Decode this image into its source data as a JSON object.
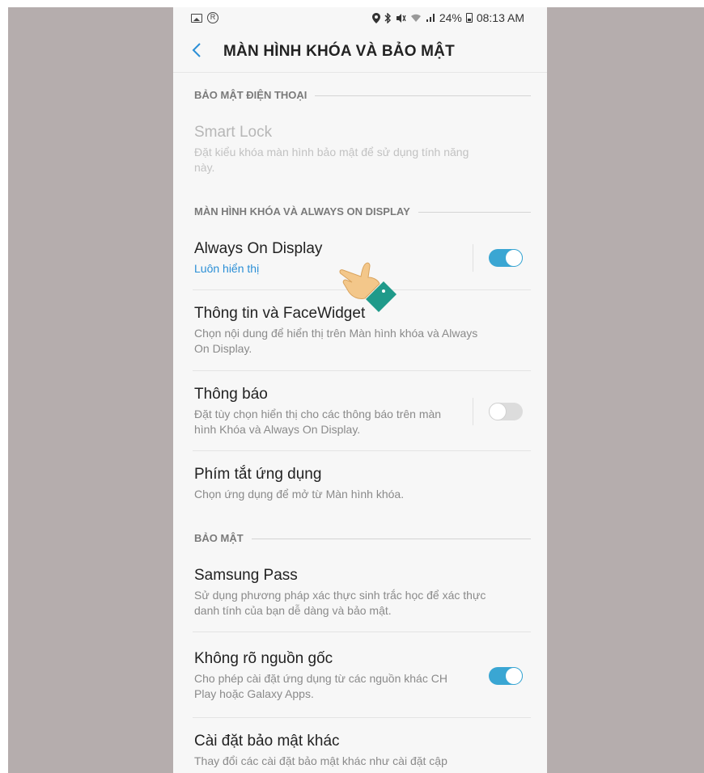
{
  "status_bar": {
    "battery": "24%",
    "time": "08:13 AM"
  },
  "header": {
    "title": "MÀN HÌNH KHÓA VÀ BẢO MẬT"
  },
  "sections": {
    "phone_security": "BẢO MẬT ĐIỆN THOẠI",
    "lock_aod": "MÀN HÌNH KHÓA VÀ ALWAYS ON DISPLAY",
    "security": "BẢO MẬT"
  },
  "items": {
    "smart_lock": {
      "title": "Smart Lock",
      "desc": "Đặt kiểu khóa màn hình bảo mật để sử dụng tính năng này."
    },
    "aod": {
      "title": "Always On Display",
      "sub": "Luôn hiển thị",
      "toggle": "on"
    },
    "facewidget": {
      "title": "Thông tin và FaceWidget",
      "desc": "Chọn nội dung để hiển thị trên Màn hình khóa và Always On Display."
    },
    "notifications": {
      "title": "Thông báo",
      "desc": "Đặt tùy chọn hiển thị cho các thông báo trên màn hình Khóa và Always On Display.",
      "toggle": "off"
    },
    "app_shortcuts": {
      "title": "Phím tắt ứng dụng",
      "desc": "Chọn ứng dụng để mở từ Màn hình khóa."
    },
    "samsung_pass": {
      "title": "Samsung Pass",
      "desc": "Sử dụng phương pháp xác thực sinh trắc học để xác thực danh tính của bạn dễ dàng và bảo mật."
    },
    "unknown_sources": {
      "title": "Không rõ nguồn gốc",
      "desc": "Cho phép cài đặt ứng dụng từ các nguồn khác CH Play hoặc Galaxy Apps.",
      "toggle": "on"
    },
    "other_security": {
      "title": "Cài đặt bảo mật khác",
      "desc": "Thay đổi các cài đặt bảo mật khác như cài đặt cập"
    }
  },
  "icons": {
    "back": "chevron-left-icon",
    "hand": "pointing-hand-icon"
  },
  "colors": {
    "accent": "#2b8fd6",
    "toggle_on": "#3aa6d3",
    "backdrop": "#b5adad"
  }
}
